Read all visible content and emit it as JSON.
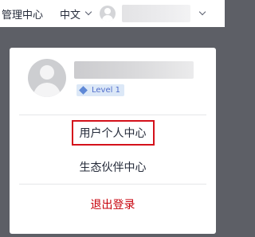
{
  "header": {
    "admin_label": "管理中心",
    "language_label": "中文"
  },
  "user_menu": {
    "level_badge": "Level 1",
    "items": [
      {
        "label": "用户个人中心"
      },
      {
        "label": "生态伙伴中心"
      }
    ],
    "logout_label": "退出登录"
  },
  "colors": {
    "highlight_border": "#d4111b",
    "logout_text": "#c7000b",
    "level_badge_bg": "#dce8f7"
  }
}
